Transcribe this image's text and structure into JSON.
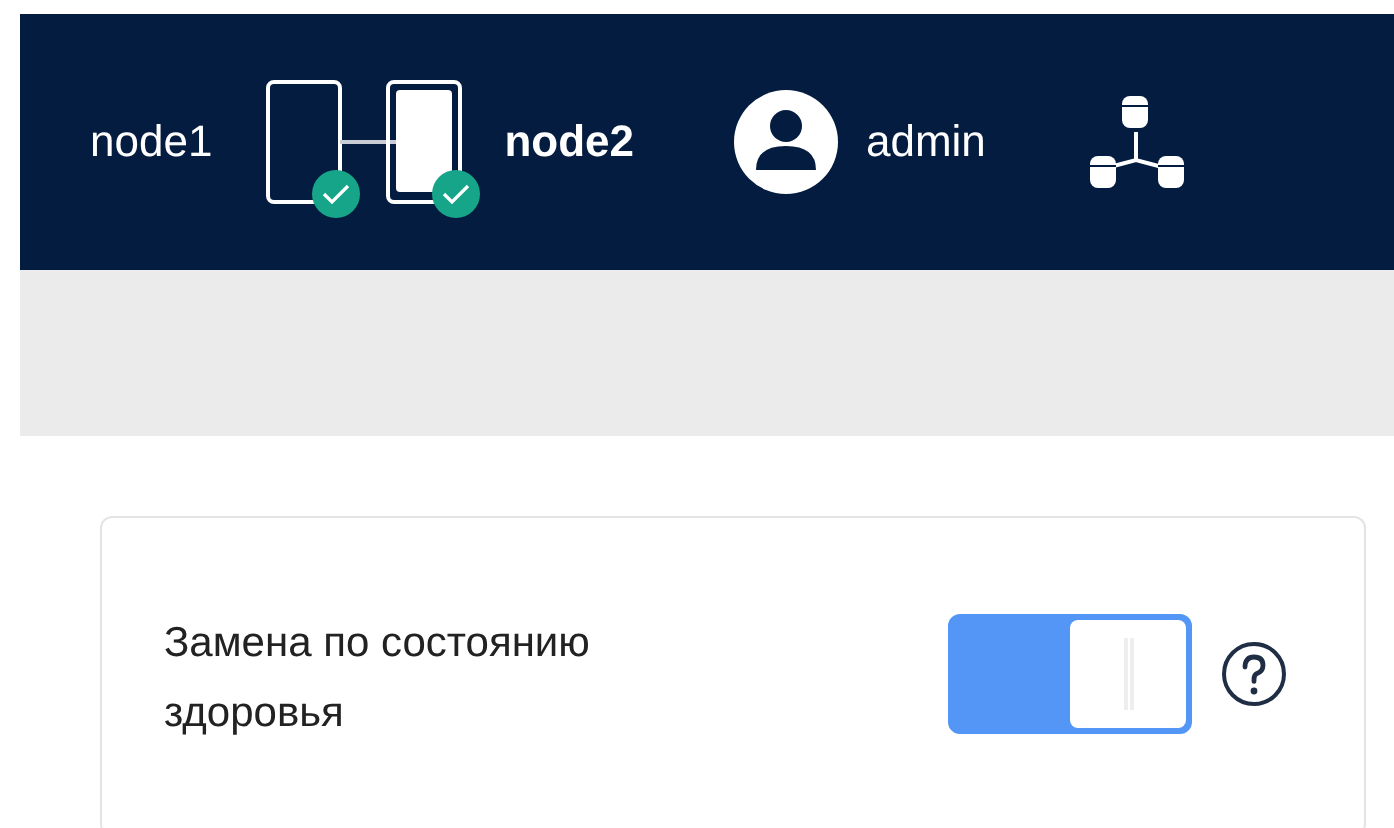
{
  "header": {
    "nodes": [
      {
        "name": "node1",
        "healthy": true,
        "selected": false
      },
      {
        "name": "node2",
        "healthy": true,
        "selected": true
      }
    ],
    "user": {
      "name": "admin"
    }
  },
  "setting": {
    "label": "Замена по состоянию здоровья",
    "on": true
  }
}
